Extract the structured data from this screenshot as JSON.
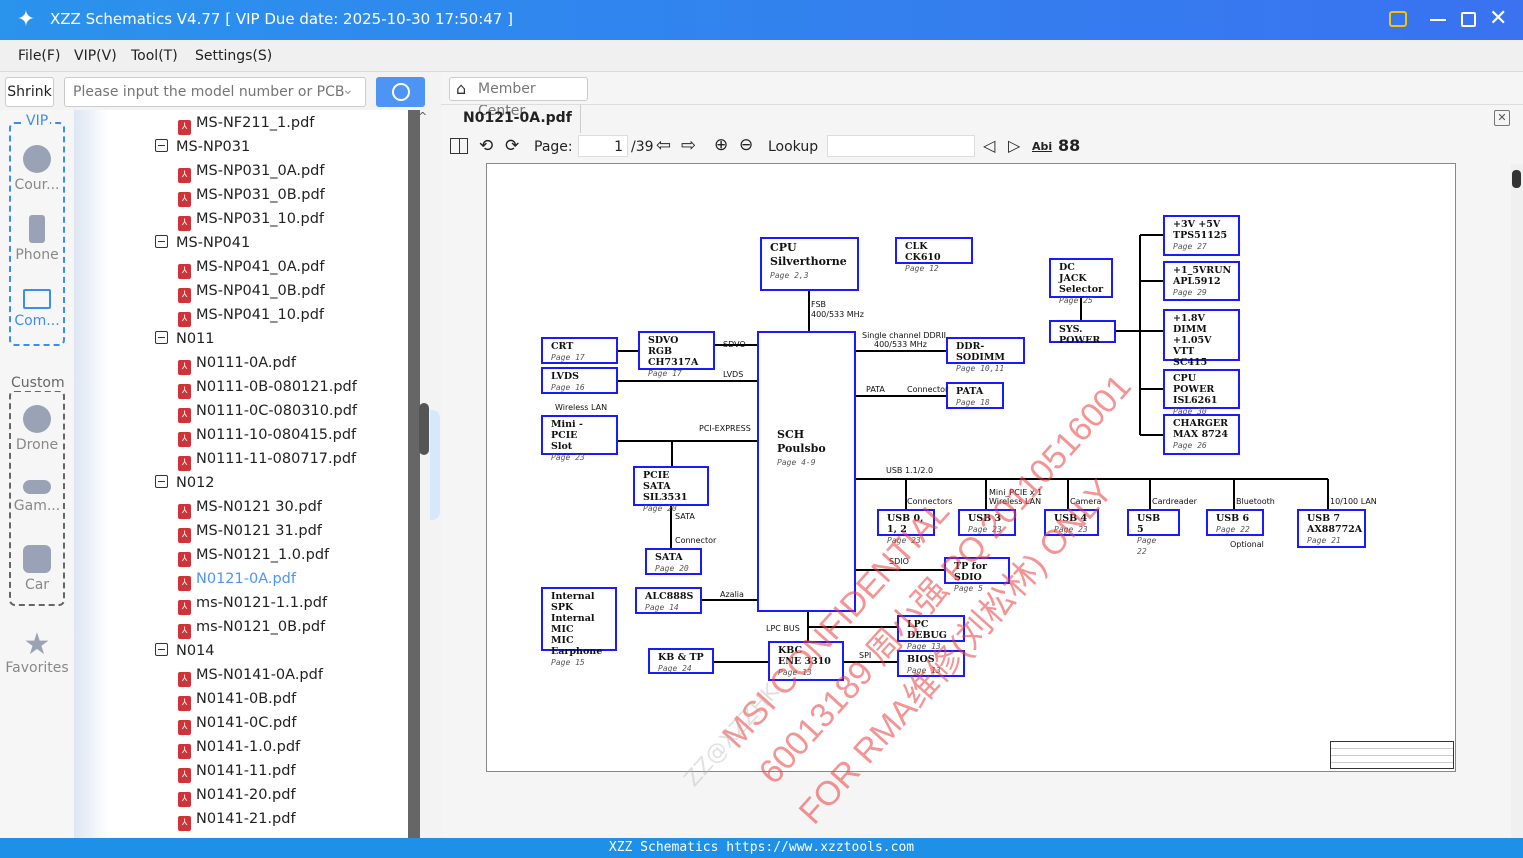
{
  "window": {
    "title": "XZZ Schematics V4.77 [ VIP Due date: 2025-10-30 17:50:47 ]"
  },
  "menu": [
    "File(F)",
    "VIP(V)",
    "Tool(T)",
    "Settings(S)"
  ],
  "search": {
    "shrink_label": "Shrink",
    "placeholder": "Please input the model number or PCB"
  },
  "nav": {
    "vip_label": "VIP",
    "custom_label": "Custom",
    "items": [
      "Cour...",
      "Phone",
      "Com...",
      "Drone",
      "Gam...",
      "Car",
      "Favorites"
    ]
  },
  "tree": [
    {
      "t": "f",
      "label": "MS-NF211_1.pdf"
    },
    {
      "t": "d",
      "label": "MS-NP031"
    },
    {
      "t": "f",
      "label": "MS-NP031_0A.pdf"
    },
    {
      "t": "f",
      "label": "MS-NP031_0B.pdf"
    },
    {
      "t": "f",
      "label": "MS-NP031_10.pdf"
    },
    {
      "t": "d",
      "label": "MS-NP041"
    },
    {
      "t": "f",
      "label": "MS-NP041_0A.pdf"
    },
    {
      "t": "f",
      "label": "MS-NP041_0B.pdf"
    },
    {
      "t": "f",
      "label": "MS-NP041_10.pdf"
    },
    {
      "t": "d",
      "label": "N011"
    },
    {
      "t": "f",
      "label": "N0111-0A.pdf"
    },
    {
      "t": "f",
      "label": "N0111-0B-080121.pdf"
    },
    {
      "t": "f",
      "label": "N0111-0C-080310.pdf"
    },
    {
      "t": "f",
      "label": "N0111-10-080415.pdf"
    },
    {
      "t": "f",
      "label": "N0111-11-080717.pdf"
    },
    {
      "t": "d",
      "label": "N012"
    },
    {
      "t": "f",
      "label": "MS-N0121 30.pdf"
    },
    {
      "t": "f",
      "label": "MS-N0121 31.pdf"
    },
    {
      "t": "f",
      "label": "MS-N0121_1.0.pdf"
    },
    {
      "t": "f",
      "label": "N0121-0A.pdf",
      "selected": true
    },
    {
      "t": "f",
      "label": "ms-N0121-1.1.pdf"
    },
    {
      "t": "f",
      "label": "ms-N0121_0B.pdf"
    },
    {
      "t": "d",
      "label": "N014"
    },
    {
      "t": "f",
      "label": "MS-N0141-0A.pdf"
    },
    {
      "t": "f",
      "label": "N0141-0B.pdf"
    },
    {
      "t": "f",
      "label": "N0141-0C.pdf"
    },
    {
      "t": "f",
      "label": "N0141-1.0.pdf"
    },
    {
      "t": "f",
      "label": "N0141-11.pdf"
    },
    {
      "t": "f",
      "label": "N0141-20.pdf"
    },
    {
      "t": "f",
      "label": "N0141-21.pdf"
    }
  ],
  "viewer": {
    "member_center": "Member Center",
    "tab": "N0121-0A.pdf",
    "page_label": "Page:",
    "page_current": "1",
    "page_total": "/39",
    "lookup_label": "Lookup",
    "lookup_value": ""
  },
  "schematic": {
    "blocks": {
      "cpu": {
        "lines": [
          "CPU",
          "Silverthorne"
        ],
        "page": "Page 2,3"
      },
      "clk": {
        "lines": [
          "CLK CK610"
        ],
        "page": "Page 12"
      },
      "dcjack": {
        "lines": [
          "DC JACK",
          "Selector"
        ],
        "page": "Page 25"
      },
      "syspower": {
        "lines": [
          "SYS. POWER"
        ],
        "page": ""
      },
      "p3v": {
        "lines": [
          "+3V +5V",
          "TPS51125"
        ],
        "page": "Page 27"
      },
      "p15": {
        "lines": [
          "+1_5VRUN",
          "APL5912"
        ],
        "page": "Page 29"
      },
      "p18": {
        "lines": [
          "+1.8V DIMM",
          "+1.05V VTT",
          "SC415"
        ],
        "page": "Page 28"
      },
      "cpupower": {
        "lines": [
          "CPU POWER",
          "ISL6261"
        ],
        "page": "Page 30"
      },
      "charger": {
        "lines": [
          "CHARGER",
          "MAX 8724"
        ],
        "page": "Page 26"
      },
      "crt": {
        "lines": [
          "CRT"
        ],
        "page": "Page 17"
      },
      "sdvo": {
        "lines": [
          "SDVO RGB",
          "CH7317A"
        ],
        "page": "Page 17"
      },
      "lvds": {
        "lines": [
          "LVDS"
        ],
        "page": "Page 16"
      },
      "minipcie": {
        "lines": [
          "Mini - PCIE",
          "Slot"
        ],
        "page": "Page 23"
      },
      "sch": {
        "lines": [
          "SCH",
          "Poulsbo"
        ],
        "page": "Page 4-9"
      },
      "ddr": {
        "lines": [
          "DDR-SODIMM"
        ],
        "page": "Page 10,11"
      },
      "pata": {
        "lines": [
          "PATA"
        ],
        "page": "Page 18"
      },
      "pciesata": {
        "lines": [
          "PCIE SATA",
          "SIL3531"
        ],
        "page": "Page 20"
      },
      "sata": {
        "lines": [
          "SATA"
        ],
        "page": "Page 20"
      },
      "usb012": {
        "lines": [
          "USB 0, 1, 2"
        ],
        "page": "Page 23"
      },
      "usb3": {
        "lines": [
          "USB 3"
        ],
        "page": "Page 23"
      },
      "usb4": {
        "lines": [
          "USB 4"
        ],
        "page": "Page 23"
      },
      "usb5": {
        "lines": [
          "USB 5"
        ],
        "page": "Page 22"
      },
      "usb6": {
        "lines": [
          "USB 6"
        ],
        "page": "Page 22"
      },
      "usb7": {
        "lines": [
          "USB 7",
          "AX88772A"
        ],
        "page": "Page 21"
      },
      "tpsdio": {
        "lines": [
          "TP for SDIO"
        ],
        "page": "Page 5"
      },
      "audio": {
        "lines": [
          "Internal SPK",
          "Internal MIC",
          "MIC",
          "Earphone"
        ],
        "page": "Page 15"
      },
      "alc": {
        "lines": [
          "ALC888S"
        ],
        "page": "Page 14"
      },
      "lpcdebug": {
        "lines": [
          "LPC DEBUG"
        ],
        "page": "Page 13"
      },
      "kbc": {
        "lines": [
          "KBC",
          "ENE 3310"
        ],
        "page": "Page 13"
      },
      "kbtp": {
        "lines": [
          "KB & TP"
        ],
        "page": "Page 24"
      },
      "bios": {
        "lines": [
          "BIOS"
        ],
        "page": "Page 13"
      }
    },
    "labels": {
      "fsb": "FSB",
      "fsb_speed": "400/533  MHz",
      "ddr_bus": "Single channel DDRII",
      "ddr_speed": "400/533  MHz",
      "sdvo": "SDVO",
      "lvds": "LVDS",
      "wlan": "Wireless LAN",
      "pciex": "PCI-EXPRESS",
      "pata": "PATA",
      "connector": "Connector",
      "usb": "USB 1.1/2.0",
      "conn2": "Connectors",
      "minipcie": "Mini_PCIE x 1",
      "wlan2": "Wireless LAN",
      "camera": "Camera",
      "card": "Cardreader",
      "bt": "Bluetooth",
      "lan": "10/100 LAN",
      "optional": "Optional",
      "sata": "SATA",
      "sataconn": "Connector",
      "sdio": "SDIO",
      "azalia": "Azalia",
      "lpc": "LPC BUS",
      "spi": "SPI"
    },
    "watermarks": [
      "MSI  CONFIDENTIAL",
      "60013189 周小强 PQ 20110516001",
      "FOR RMA维修(刘松林) ONLY",
      "ZZ@XZZHK"
    ]
  },
  "status": "XZZ Schematics https://www.xzztools.com"
}
